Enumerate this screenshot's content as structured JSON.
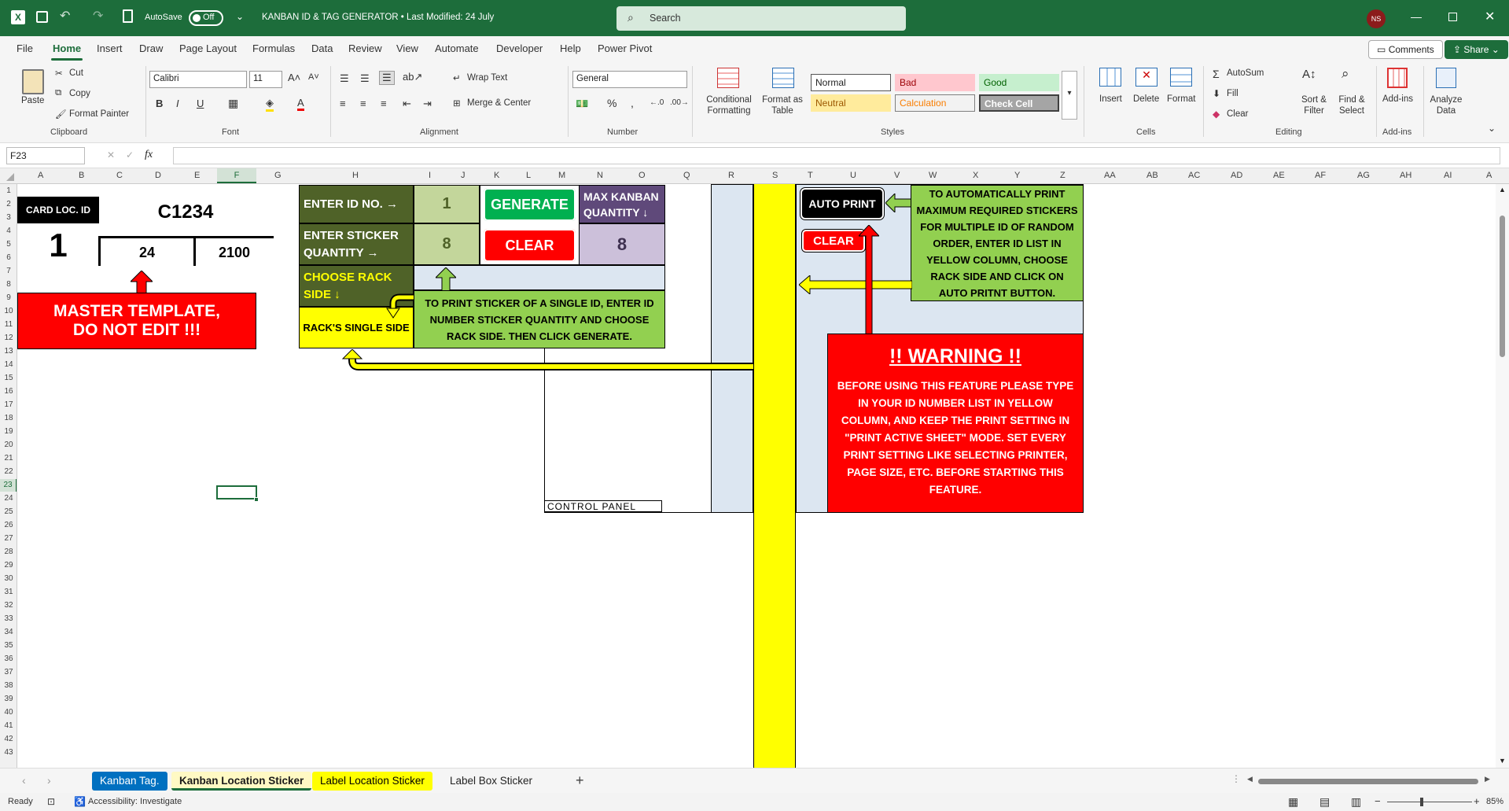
{
  "titlebar": {
    "autosave_label": "AutoSave",
    "autosave_state": "Off",
    "doc_title": "KANBAN ID & TAG GENERATOR • Last Modified: 24 July",
    "search_placeholder": "Search",
    "user_initials": "NS"
  },
  "menu": {
    "items": [
      "File",
      "Home",
      "Insert",
      "Draw",
      "Page Layout",
      "Formulas",
      "Data",
      "Review",
      "View",
      "Automate",
      "Developer",
      "Help",
      "Power Pivot"
    ],
    "comments": "Comments",
    "share": "Share"
  },
  "ribbon": {
    "clipboard": {
      "paste": "Paste",
      "cut": "Cut",
      "copy": "Copy",
      "format_painter": "Format Painter",
      "group": "Clipboard"
    },
    "font": {
      "name": "Calibri",
      "size": "11",
      "group": "Font"
    },
    "alignment": {
      "wrap": "Wrap Text",
      "merge": "Merge & Center",
      "group": "Alignment"
    },
    "number": {
      "format": "General",
      "group": "Number"
    },
    "styles": {
      "cond": "Conditional Formatting",
      "table": "Format as Table",
      "normal": "Normal",
      "bad": "Bad",
      "good": "Good",
      "neutral": "Neutral",
      "calculation": "Calculation",
      "check": "Check Cell",
      "group": "Styles"
    },
    "cells": {
      "insert": "Insert",
      "delete": "Delete",
      "format": "Format",
      "group": "Cells"
    },
    "editing": {
      "autosum": "AutoSum",
      "fill": "Fill",
      "clear": "Clear",
      "sort": "Sort & Filter",
      "find": "Find & Select",
      "group": "Editing"
    },
    "addins": {
      "label": "Add-ins",
      "group": "Add-ins"
    },
    "analyze": {
      "label": "Analyze Data"
    }
  },
  "formula_bar": {
    "cell_ref": "F23",
    "fx": "fx"
  },
  "columns": [
    "A",
    "B",
    "C",
    "D",
    "E",
    "F",
    "G",
    "H",
    "I",
    "J",
    "K",
    "L",
    "M",
    "N",
    "O",
    "Q",
    "R",
    "S",
    "T",
    "U",
    "V",
    "W",
    "X",
    "Y",
    "Z",
    "AA",
    "AB",
    "AC",
    "AD",
    "AE",
    "AF",
    "AG",
    "AH",
    "AI",
    "A"
  ],
  "rows": [
    "1",
    "2",
    "3",
    "4",
    "5",
    "6",
    "7",
    "8",
    "9",
    "10",
    "11",
    "12",
    "13",
    "14",
    "15",
    "16",
    "17",
    "18",
    "19",
    "20",
    "21",
    "22",
    "23",
    "24",
    "25",
    "26",
    "27",
    "28",
    "29",
    "30",
    "31",
    "32",
    "33",
    "34",
    "35",
    "36",
    "37",
    "38",
    "39",
    "40",
    "41",
    "42",
    "43"
  ],
  "sheet": {
    "card_loc_label": "CARD LOC. ID",
    "card_code": "C1234",
    "card_num": "1",
    "card_val1": "24",
    "card_val2": "2100",
    "master_line1": "MASTER TEMPLATE,",
    "master_line2": "DO NOT EDIT !!!",
    "enter_id_label": "ENTER ID NO. →",
    "enter_id_value": "1",
    "enter_qty_label": "ENTER STICKER QUANTITY →",
    "enter_qty_value": "8",
    "generate": "GENERATE",
    "clear": "CLEAR",
    "max_kanban_label": "MAX KANBAN QUANTITY ↓",
    "max_kanban_value": "8",
    "choose_rack": "CHOOSE RACK SIDE ↓",
    "rack_single": "RACK'S SINGLE SIDE",
    "single_instr": "TO PRINT STICKER OF A SINGLE ID, ENTER ID NUMBER STICKER QUANTITY AND CHOOSE RACK SIDE. THEN CLICK GENERATE.",
    "control_panel": "CONTROL PANEL",
    "auto_print": "AUTO PRINT",
    "auto_clear": "CLEAR",
    "auto_instr": "TO AUTOMATICALLY PRINT MAXIMUM REQUIRED STICKERS FOR MULTIPLE ID OF RANDOM ORDER, ENTER ID LIST IN YELLOW COLUMN, CHOOSE RACK SIDE AND CLICK ON AUTO PRITNT BUTTON.",
    "warning_title": "!! WARNING !!",
    "warning_body": "BEFORE USING THIS FEATURE PLEASE TYPE IN YOUR ID NUMBER LIST IN YELLOW COLUMN, AND KEEP THE PRINT SETTING IN \"PRINT ACTIVE SHEET\" MODE. SET EVERY PRINT SETTING LIKE SELECTING PRINTER, PAGE SIZE, ETC. BEFORE STARTING THIS FEATURE."
  },
  "tabs": [
    "Kanban Tag.",
    "Kanban Location Sticker",
    "Label Location Sticker",
    "Label Box Sticker"
  ],
  "status": {
    "ready": "Ready",
    "accessibility": "Accessibility: Investigate",
    "zoom": "85%"
  },
  "colors": {
    "excel_green": "#1d6d3b",
    "dark_olive": "#4f6228",
    "light_green": "#c3d69b",
    "yellow": "#ffff00",
    "red": "#ff0000",
    "panel_blue": "#dce6f1",
    "purple": "#5f497a",
    "lavender": "#ccc0da",
    "instr_green": "#92d050"
  }
}
